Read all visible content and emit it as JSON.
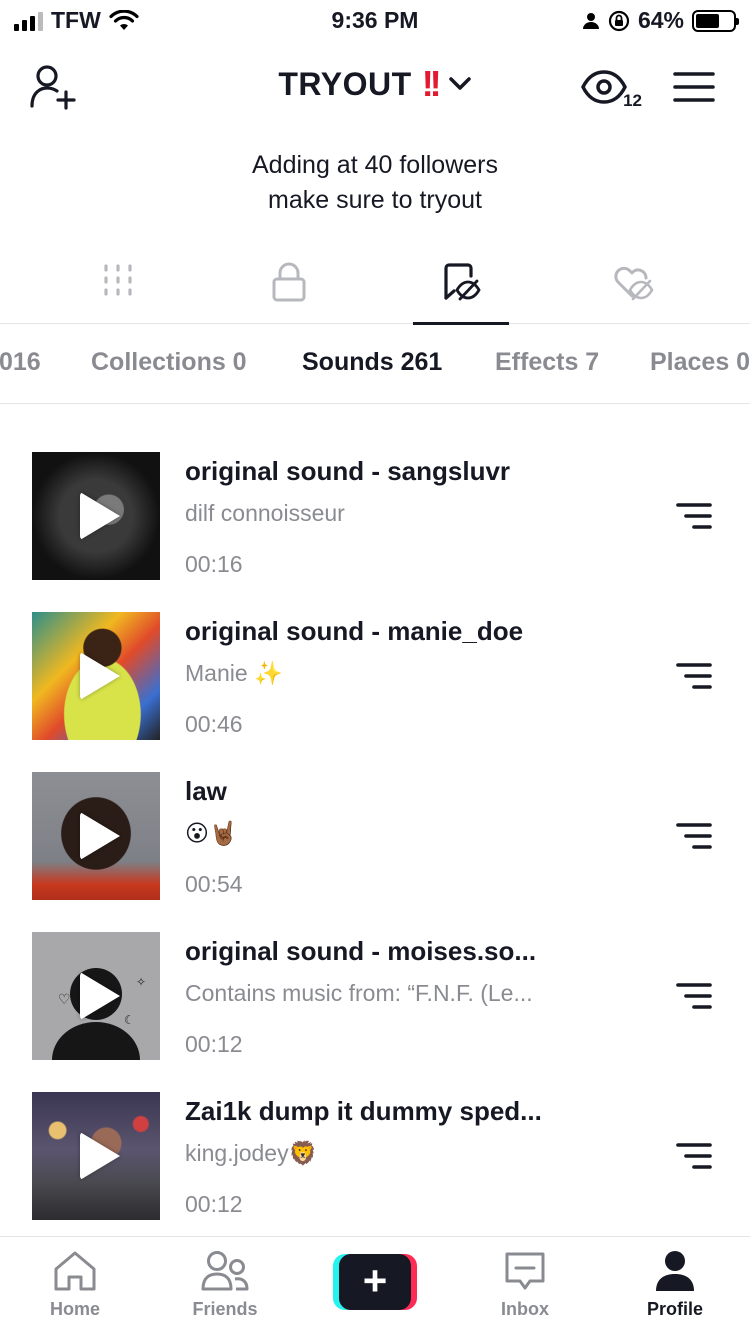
{
  "status_bar": {
    "carrier": "TFW",
    "time": "9:36 PM",
    "battery": "64%",
    "battery_level": 0.64
  },
  "header": {
    "title": "TRYOUT",
    "title_emoji": "!!",
    "views_count": "12",
    "icons": [
      "add-user-icon",
      "chevron-down-icon",
      "eye-icon",
      "hamburger-menu-icon"
    ]
  },
  "bio": {
    "line1": "Adding at 40 followers",
    "line2": "make sure to tryout"
  },
  "icon_tabs": [
    {
      "name": "videos",
      "icon": "grid-icon"
    },
    {
      "name": "private",
      "icon": "lock-icon"
    },
    {
      "name": "saved",
      "icon": "bookmark-eye-icon",
      "active": true
    },
    {
      "name": "liked",
      "icon": "heart-eye-icon"
    }
  ],
  "text_tabs": [
    {
      "label": "016"
    },
    {
      "label": "Collections 0"
    },
    {
      "label": "Sounds 261",
      "active": true
    },
    {
      "label": "Effects 7"
    },
    {
      "label": "Places 0"
    }
  ],
  "sounds": [
    {
      "title": "original sound - sangsluvr",
      "author": "dilf connoisseur",
      "duration": "00:16"
    },
    {
      "title": "original sound - manie_doe",
      "author": "Manie ✨",
      "duration": "00:46"
    },
    {
      "title": "law",
      "author": "😮🤘🏾",
      "duration": "00:54"
    },
    {
      "title": "original sound - moises.so...",
      "author": "Contains music from: “F.N.F. (Le...",
      "duration": "00:12"
    },
    {
      "title": "Zai1k dump it dummy sped...",
      "author": "king.jodey🦁",
      "duration": "00:12"
    }
  ],
  "bottom_nav": {
    "home": "Home",
    "friends": "Friends",
    "create": "+",
    "inbox": "Inbox",
    "profile": "Profile"
  },
  "colors": {
    "text": "#161823",
    "muted": "#8a8b91",
    "accent_red": "#e3192f",
    "create_cyan": "#25f4ee",
    "create_pink": "#fe2c55"
  }
}
